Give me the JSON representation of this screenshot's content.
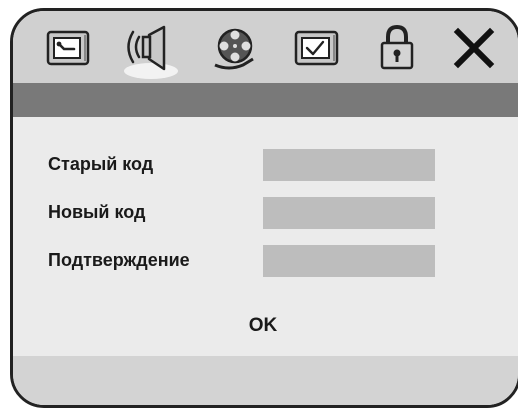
{
  "toolbar": {
    "tabs": [
      {
        "icon": "wrench-tv-icon"
      },
      {
        "icon": "speaker-icon",
        "selected": true
      },
      {
        "icon": "film-reel-icon"
      },
      {
        "icon": "checkbox-tv-icon"
      },
      {
        "icon": "padlock-icon"
      },
      {
        "icon": "close-icon"
      }
    ]
  },
  "form": {
    "old_code_label": "Старый код",
    "old_code_value": "",
    "new_code_label": "Новый код",
    "new_code_value": "",
    "confirm_label": "Подтверждение",
    "confirm_value": "",
    "ok_label": "OK"
  },
  "colors": {
    "frame": "#222222",
    "toolbar": "#d0d0d0",
    "titlebar": "#797979",
    "panel": "#ebebeb",
    "field": "#bdbdbd",
    "selected_tab_glow": "#f2f2f2"
  }
}
